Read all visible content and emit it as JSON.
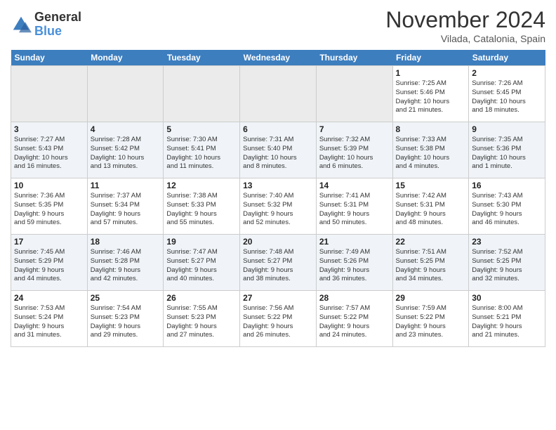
{
  "header": {
    "logo_general": "General",
    "logo_blue": "Blue",
    "title": "November 2024",
    "location": "Vilada, Catalonia, Spain"
  },
  "weekdays": [
    "Sunday",
    "Monday",
    "Tuesday",
    "Wednesday",
    "Thursday",
    "Friday",
    "Saturday"
  ],
  "weeks": [
    {
      "shaded": false,
      "days": [
        {
          "num": "",
          "info": ""
        },
        {
          "num": "",
          "info": ""
        },
        {
          "num": "",
          "info": ""
        },
        {
          "num": "",
          "info": ""
        },
        {
          "num": "",
          "info": ""
        },
        {
          "num": "1",
          "info": "Sunrise: 7:25 AM\nSunset: 5:46 PM\nDaylight: 10 hours\nand 21 minutes."
        },
        {
          "num": "2",
          "info": "Sunrise: 7:26 AM\nSunset: 5:45 PM\nDaylight: 10 hours\nand 18 minutes."
        }
      ]
    },
    {
      "shaded": true,
      "days": [
        {
          "num": "3",
          "info": "Sunrise: 7:27 AM\nSunset: 5:43 PM\nDaylight: 10 hours\nand 16 minutes."
        },
        {
          "num": "4",
          "info": "Sunrise: 7:28 AM\nSunset: 5:42 PM\nDaylight: 10 hours\nand 13 minutes."
        },
        {
          "num": "5",
          "info": "Sunrise: 7:30 AM\nSunset: 5:41 PM\nDaylight: 10 hours\nand 11 minutes."
        },
        {
          "num": "6",
          "info": "Sunrise: 7:31 AM\nSunset: 5:40 PM\nDaylight: 10 hours\nand 8 minutes."
        },
        {
          "num": "7",
          "info": "Sunrise: 7:32 AM\nSunset: 5:39 PM\nDaylight: 10 hours\nand 6 minutes."
        },
        {
          "num": "8",
          "info": "Sunrise: 7:33 AM\nSunset: 5:38 PM\nDaylight: 10 hours\nand 4 minutes."
        },
        {
          "num": "9",
          "info": "Sunrise: 7:35 AM\nSunset: 5:36 PM\nDaylight: 10 hours\nand 1 minute."
        }
      ]
    },
    {
      "shaded": false,
      "days": [
        {
          "num": "10",
          "info": "Sunrise: 7:36 AM\nSunset: 5:35 PM\nDaylight: 9 hours\nand 59 minutes."
        },
        {
          "num": "11",
          "info": "Sunrise: 7:37 AM\nSunset: 5:34 PM\nDaylight: 9 hours\nand 57 minutes."
        },
        {
          "num": "12",
          "info": "Sunrise: 7:38 AM\nSunset: 5:33 PM\nDaylight: 9 hours\nand 55 minutes."
        },
        {
          "num": "13",
          "info": "Sunrise: 7:40 AM\nSunset: 5:32 PM\nDaylight: 9 hours\nand 52 minutes."
        },
        {
          "num": "14",
          "info": "Sunrise: 7:41 AM\nSunset: 5:31 PM\nDaylight: 9 hours\nand 50 minutes."
        },
        {
          "num": "15",
          "info": "Sunrise: 7:42 AM\nSunset: 5:31 PM\nDaylight: 9 hours\nand 48 minutes."
        },
        {
          "num": "16",
          "info": "Sunrise: 7:43 AM\nSunset: 5:30 PM\nDaylight: 9 hours\nand 46 minutes."
        }
      ]
    },
    {
      "shaded": true,
      "days": [
        {
          "num": "17",
          "info": "Sunrise: 7:45 AM\nSunset: 5:29 PM\nDaylight: 9 hours\nand 44 minutes."
        },
        {
          "num": "18",
          "info": "Sunrise: 7:46 AM\nSunset: 5:28 PM\nDaylight: 9 hours\nand 42 minutes."
        },
        {
          "num": "19",
          "info": "Sunrise: 7:47 AM\nSunset: 5:27 PM\nDaylight: 9 hours\nand 40 minutes."
        },
        {
          "num": "20",
          "info": "Sunrise: 7:48 AM\nSunset: 5:27 PM\nDaylight: 9 hours\nand 38 minutes."
        },
        {
          "num": "21",
          "info": "Sunrise: 7:49 AM\nSunset: 5:26 PM\nDaylight: 9 hours\nand 36 minutes."
        },
        {
          "num": "22",
          "info": "Sunrise: 7:51 AM\nSunset: 5:25 PM\nDaylight: 9 hours\nand 34 minutes."
        },
        {
          "num": "23",
          "info": "Sunrise: 7:52 AM\nSunset: 5:25 PM\nDaylight: 9 hours\nand 32 minutes."
        }
      ]
    },
    {
      "shaded": false,
      "days": [
        {
          "num": "24",
          "info": "Sunrise: 7:53 AM\nSunset: 5:24 PM\nDaylight: 9 hours\nand 31 minutes."
        },
        {
          "num": "25",
          "info": "Sunrise: 7:54 AM\nSunset: 5:23 PM\nDaylight: 9 hours\nand 29 minutes."
        },
        {
          "num": "26",
          "info": "Sunrise: 7:55 AM\nSunset: 5:23 PM\nDaylight: 9 hours\nand 27 minutes."
        },
        {
          "num": "27",
          "info": "Sunrise: 7:56 AM\nSunset: 5:22 PM\nDaylight: 9 hours\nand 26 minutes."
        },
        {
          "num": "28",
          "info": "Sunrise: 7:57 AM\nSunset: 5:22 PM\nDaylight: 9 hours\nand 24 minutes."
        },
        {
          "num": "29",
          "info": "Sunrise: 7:59 AM\nSunset: 5:22 PM\nDaylight: 9 hours\nand 23 minutes."
        },
        {
          "num": "30",
          "info": "Sunrise: 8:00 AM\nSunset: 5:21 PM\nDaylight: 9 hours\nand 21 minutes."
        }
      ]
    }
  ]
}
